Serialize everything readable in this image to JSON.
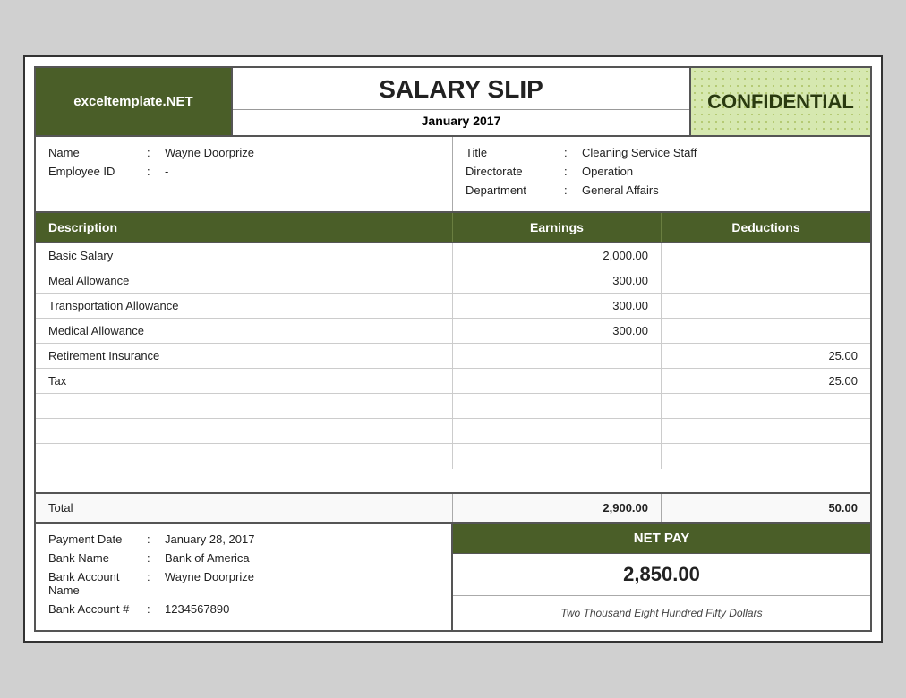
{
  "header": {
    "logo_text": "exceltemplate.NET",
    "title": "SALARY SLIP",
    "month": "January 2017",
    "confidential": "CONFIDENTIAL"
  },
  "employee": {
    "name_label": "Name",
    "name_colon": ":",
    "name_value": "Wayne Doorprize",
    "id_label": "Employee ID",
    "id_colon": ":",
    "id_value": "-",
    "title_label": "Title",
    "title_colon": ":",
    "title_value": "Cleaning Service Staff",
    "directorate_label": "Directorate",
    "directorate_colon": ":",
    "directorate_value": "Operation",
    "department_label": "Department",
    "department_colon": ":",
    "department_value": "General Affairs"
  },
  "table": {
    "col_description": "Description",
    "col_earnings": "Earnings",
    "col_deductions": "Deductions",
    "rows": [
      {
        "desc": "Basic Salary",
        "earnings": "2,000.00",
        "deductions": ""
      },
      {
        "desc": "Meal Allowance",
        "earnings": "300.00",
        "deductions": ""
      },
      {
        "desc": "Transportation Allowance",
        "earnings": "300.00",
        "deductions": ""
      },
      {
        "desc": "Medical Allowance",
        "earnings": "300.00",
        "deductions": ""
      },
      {
        "desc": "Retirement Insurance",
        "earnings": "",
        "deductions": "25.00"
      },
      {
        "desc": "Tax",
        "earnings": "",
        "deductions": "25.00"
      }
    ],
    "total_label": "Total",
    "total_earnings": "2,900.00",
    "total_deductions": "50.00"
  },
  "footer": {
    "payment_date_label": "Payment Date",
    "payment_date_colon": ":",
    "payment_date_value": "January 28, 2017",
    "bank_name_label": "Bank Name",
    "bank_name_colon": ":",
    "bank_name_value": "Bank of America",
    "bank_account_name_label": "Bank Account Name",
    "bank_account_name_colon": ":",
    "bank_account_name_value": "Wayne Doorprize",
    "bank_account_num_label": "Bank Account #",
    "bank_account_num_colon": ":",
    "bank_account_num_value": "1234567890",
    "net_pay_label": "NET PAY",
    "net_pay_value": "2,850.00",
    "net_pay_words": "Two Thousand Eight Hundred Fifty Dollars"
  }
}
